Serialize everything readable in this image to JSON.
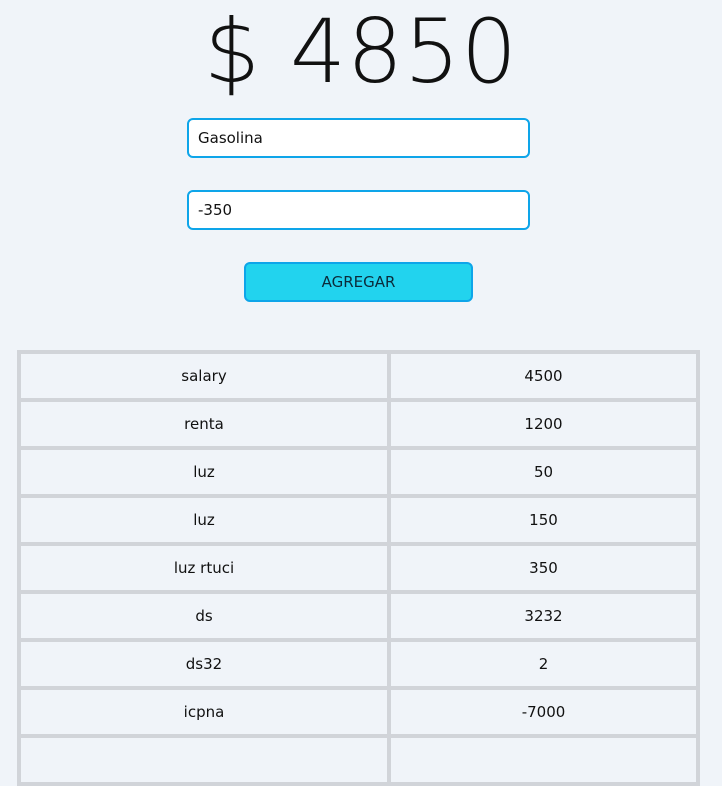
{
  "balance": "$ 4850",
  "form": {
    "description_value": "Gasolina",
    "amount_value": "-350",
    "add_label": "AGREGAR"
  },
  "entries": [
    {
      "name": "salary",
      "amount": "4500"
    },
    {
      "name": "renta",
      "amount": "1200"
    },
    {
      "name": "luz",
      "amount": "50"
    },
    {
      "name": "luz",
      "amount": "150"
    },
    {
      "name": "luz rtuci",
      "amount": "350"
    },
    {
      "name": "ds",
      "amount": "3232"
    },
    {
      "name": "ds32",
      "amount": "2"
    },
    {
      "name": "icpna",
      "amount": "-7000"
    },
    {
      "name": "",
      "amount": ""
    }
  ]
}
